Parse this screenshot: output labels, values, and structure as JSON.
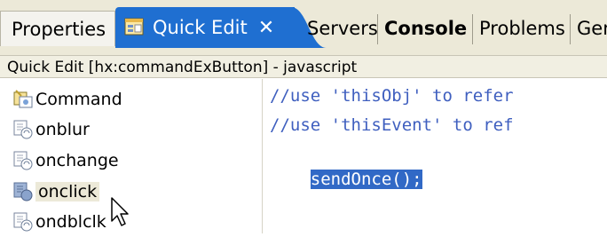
{
  "tabs": [
    {
      "label": "Properties"
    },
    {
      "label": "Quick Edit",
      "close": "✕"
    },
    {
      "label": "Servers"
    },
    {
      "label": "Console"
    },
    {
      "label": "Problems"
    },
    {
      "label": "Gene"
    }
  ],
  "title": "Quick Edit [hx:commandExButton] - javascript",
  "events": [
    {
      "label": "Command"
    },
    {
      "label": "onblur"
    },
    {
      "label": "onchange"
    },
    {
      "label": "onclick"
    },
    {
      "label": "ondblclk"
    }
  ],
  "editor": {
    "lines": [
      "//use 'thisObj' to refer",
      "//use 'thisEvent' to ref",
      "sendOnce();"
    ]
  },
  "colors": {
    "active_tab": "#1f6fd1",
    "selection": "#3169c6",
    "comment": "#3f5fbf",
    "chrome": "#ece9d8"
  },
  "icons": {
    "quick_edit": "quick-edit-icon",
    "command": "command-icon",
    "event": "event-icon",
    "cursor": "mouse-cursor-icon"
  }
}
